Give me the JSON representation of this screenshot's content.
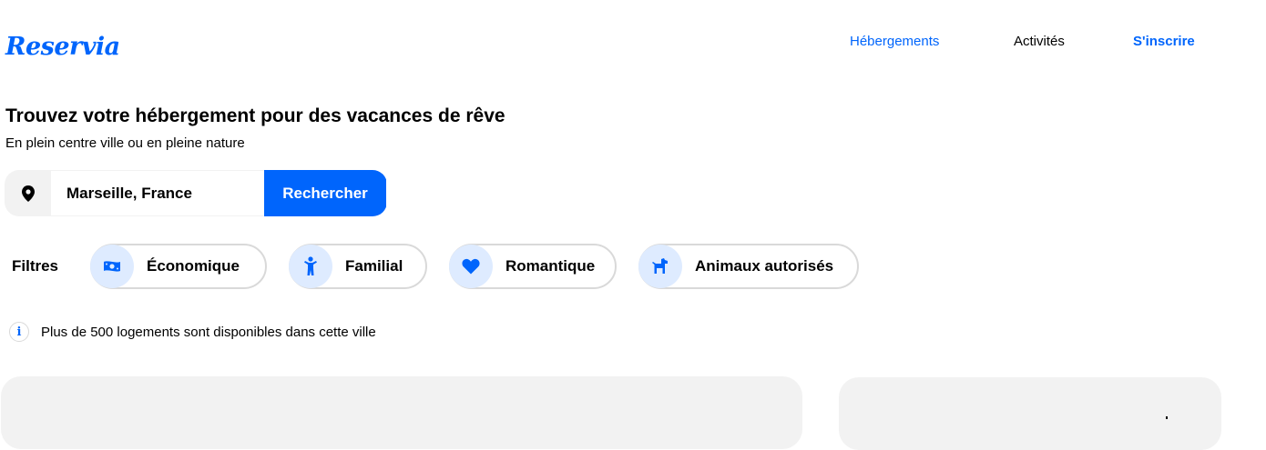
{
  "header": {
    "logo": "Reservia",
    "nav": [
      "Hébergements",
      "Activités",
      "S'inscrire"
    ]
  },
  "hero": {
    "title": "Trouvez votre hébergement pour des vacances de rêve",
    "subtitle": "En plein centre ville ou en pleine nature"
  },
  "search": {
    "icon": "map-pin-icon",
    "value": "Marseille, France",
    "button_label": "Rechercher"
  },
  "filters": {
    "label": "Filtres",
    "items": [
      {
        "label": "Économique",
        "icon": "money-icon"
      },
      {
        "label": "Familial",
        "icon": "child-icon"
      },
      {
        "label": "Romantique",
        "icon": "heart-icon"
      },
      {
        "label": "Animaux autorisés",
        "icon": "dog-icon"
      }
    ]
  },
  "info": {
    "icon": "info-icon",
    "text": "Plus de 500 logements sont disponibles dans cette ville"
  },
  "colors": {
    "accent": "#0065fc",
    "chip_icon_bg": "#deebff",
    "panel_bg": "#f2f2f2",
    "chip_border": "#d9d9d9"
  }
}
